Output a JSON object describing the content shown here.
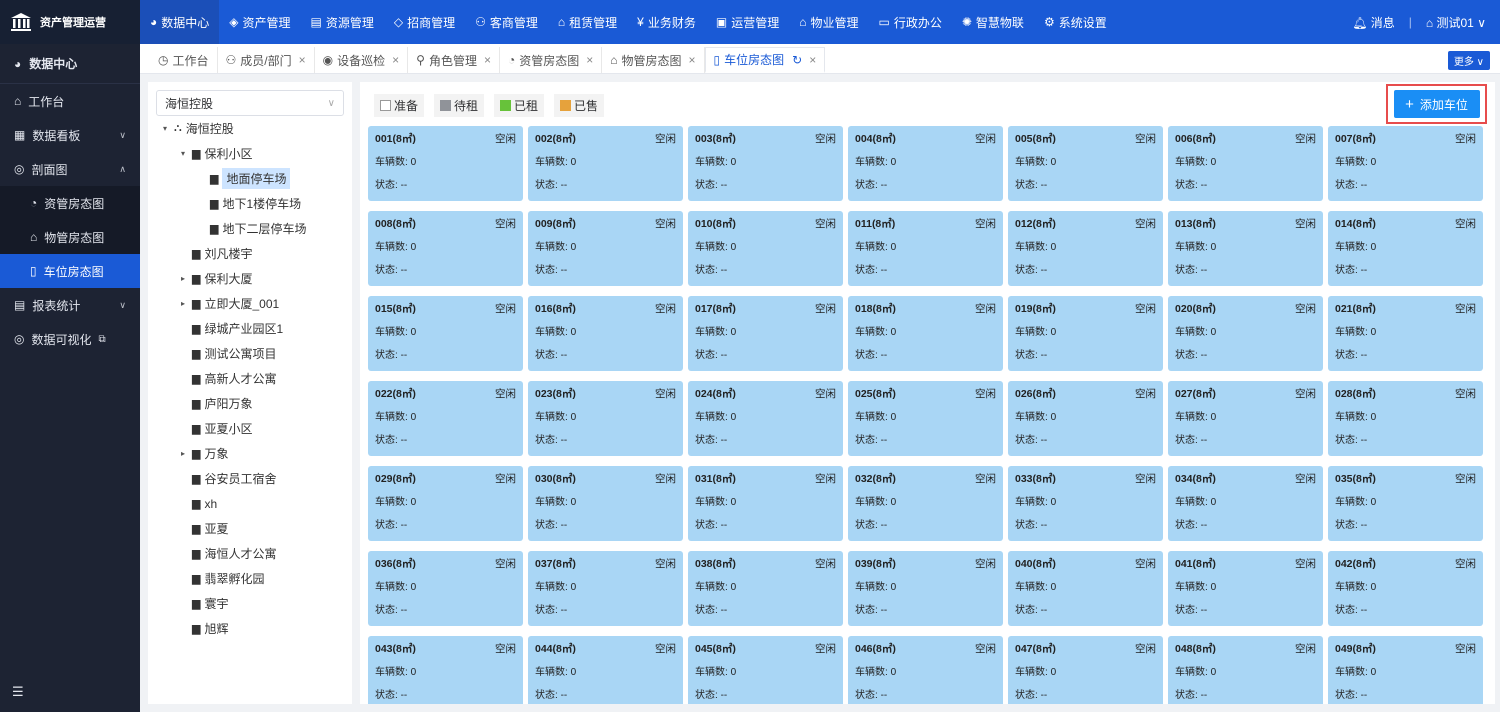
{
  "app": {
    "title": "资产管理运营"
  },
  "topnav": [
    {
      "label": "数据中心",
      "icon": "pie-icon",
      "active": true
    },
    {
      "label": "资产管理",
      "icon": "cube-icon"
    },
    {
      "label": "资源管理",
      "icon": "building-icon"
    },
    {
      "label": "招商管理",
      "icon": "tag-icon"
    },
    {
      "label": "客商管理",
      "icon": "users-icon"
    },
    {
      "label": "租赁管理",
      "icon": "house-icon"
    },
    {
      "label": "业务财务",
      "icon": "yen-icon"
    },
    {
      "label": "运营管理",
      "icon": "image-icon"
    },
    {
      "label": "物业管理",
      "icon": "home-icon"
    },
    {
      "label": "行政办公",
      "icon": "monitor-icon"
    },
    {
      "label": "智慧物联",
      "icon": "iot-icon"
    },
    {
      "label": "系统设置",
      "icon": "gear-icon"
    }
  ],
  "top_right": {
    "message": "消息",
    "user": "测试01"
  },
  "sidebar": {
    "header": "数据中心",
    "items": [
      {
        "label": "工作台"
      },
      {
        "label": "数据看板",
        "caret": "∨"
      },
      {
        "label": "剖面图",
        "caret": "∧"
      }
    ],
    "sub": [
      {
        "label": "资管房态图"
      },
      {
        "label": "物管房态图"
      },
      {
        "label": "车位房态图",
        "active": true
      }
    ],
    "items2": [
      {
        "label": "报表统计",
        "caret": "∨"
      },
      {
        "label": "数据可视化"
      }
    ]
  },
  "tabs": [
    {
      "label": "工作台",
      "close": false
    },
    {
      "label": "成员/部门",
      "close": true
    },
    {
      "label": "设备巡检",
      "close": true
    },
    {
      "label": "角色管理",
      "close": true
    },
    {
      "label": "资管房态图",
      "close": true
    },
    {
      "label": "物管房态图",
      "close": true
    },
    {
      "label": "车位房态图",
      "close": true,
      "active": true
    }
  ],
  "more_label": "更多",
  "tree": {
    "select_value": "海恒控股",
    "nodes": [
      {
        "label": "海恒控股",
        "level": 0,
        "arrow": "▾",
        "icon": "org"
      },
      {
        "label": "保利小区",
        "level": 1,
        "arrow": "▾",
        "icon": "bld"
      },
      {
        "label": "地面停车场",
        "level": 2,
        "arrow": "",
        "icon": "bld",
        "selected": true
      },
      {
        "label": "地下1楼停车场",
        "level": 2,
        "arrow": "",
        "icon": "bld"
      },
      {
        "label": "地下二层停车场",
        "level": 2,
        "arrow": "",
        "icon": "bld"
      },
      {
        "label": "刘凡楼宇",
        "level": 1,
        "arrow": "",
        "icon": "bld"
      },
      {
        "label": "保利大厦",
        "level": 1,
        "arrow": "▸",
        "icon": "bld"
      },
      {
        "label": "立即大厦_001",
        "level": 1,
        "arrow": "▸",
        "icon": "bld"
      },
      {
        "label": "绿城产业园区1",
        "level": 1,
        "arrow": "",
        "icon": "bld"
      },
      {
        "label": "测试公寓项目",
        "level": 1,
        "arrow": "",
        "icon": "bld"
      },
      {
        "label": "高新人才公寓",
        "level": 1,
        "arrow": "",
        "icon": "bld"
      },
      {
        "label": "庐阳万象",
        "level": 1,
        "arrow": "",
        "icon": "bld"
      },
      {
        "label": "亚夏小区",
        "level": 1,
        "arrow": "",
        "icon": "bld"
      },
      {
        "label": "万象",
        "level": 1,
        "arrow": "▸",
        "icon": "bld"
      },
      {
        "label": "谷安员工宿舍",
        "level": 1,
        "arrow": "",
        "icon": "bld"
      },
      {
        "label": "xh",
        "level": 1,
        "arrow": "",
        "icon": "bld"
      },
      {
        "label": "亚夏",
        "level": 1,
        "arrow": "",
        "icon": "bld"
      },
      {
        "label": "海恒人才公寓",
        "level": 1,
        "arrow": "",
        "icon": "bld"
      },
      {
        "label": "翡翠孵化园",
        "level": 1,
        "arrow": "",
        "icon": "bld"
      },
      {
        "label": "寰宇",
        "level": 1,
        "arrow": "",
        "icon": "bld"
      },
      {
        "label": "旭辉",
        "level": 1,
        "arrow": "",
        "icon": "bld"
      }
    ]
  },
  "legend": [
    {
      "label": "准备",
      "color": "#ffffff"
    },
    {
      "label": "待租",
      "color": "#909399"
    },
    {
      "label": "已租",
      "color": "#67c23a"
    },
    {
      "label": "已售",
      "color": "#e6a23c"
    }
  ],
  "add_button": "添加车位",
  "card_labels": {
    "vehicles": "车辆数:",
    "status": "状态:"
  },
  "spaces": [
    {
      "name": "001(8㎡)",
      "state": "空闲",
      "vehicles": "0",
      "status": "--"
    },
    {
      "name": "002(8㎡)",
      "state": "空闲",
      "vehicles": "0",
      "status": "--"
    },
    {
      "name": "003(8㎡)",
      "state": "空闲",
      "vehicles": "0",
      "status": "--"
    },
    {
      "name": "004(8㎡)",
      "state": "空闲",
      "vehicles": "0",
      "status": "--"
    },
    {
      "name": "005(8㎡)",
      "state": "空闲",
      "vehicles": "0",
      "status": "--"
    },
    {
      "name": "006(8㎡)",
      "state": "空闲",
      "vehicles": "0",
      "status": "--"
    },
    {
      "name": "007(8㎡)",
      "state": "空闲",
      "vehicles": "0",
      "status": "--"
    },
    {
      "name": "008(8㎡)",
      "state": "空闲",
      "vehicles": "0",
      "status": "--"
    },
    {
      "name": "009(8㎡)",
      "state": "空闲",
      "vehicles": "0",
      "status": "--"
    },
    {
      "name": "010(8㎡)",
      "state": "空闲",
      "vehicles": "0",
      "status": "--"
    },
    {
      "name": "011(8㎡)",
      "state": "空闲",
      "vehicles": "0",
      "status": "--"
    },
    {
      "name": "012(8㎡)",
      "state": "空闲",
      "vehicles": "0",
      "status": "--"
    },
    {
      "name": "013(8㎡)",
      "state": "空闲",
      "vehicles": "0",
      "status": "--"
    },
    {
      "name": "014(8㎡)",
      "state": "空闲",
      "vehicles": "0",
      "status": "--"
    },
    {
      "name": "015(8㎡)",
      "state": "空闲",
      "vehicles": "0",
      "status": "--"
    },
    {
      "name": "016(8㎡)",
      "state": "空闲",
      "vehicles": "0",
      "status": "--"
    },
    {
      "name": "017(8㎡)",
      "state": "空闲",
      "vehicles": "0",
      "status": "--"
    },
    {
      "name": "018(8㎡)",
      "state": "空闲",
      "vehicles": "0",
      "status": "--"
    },
    {
      "name": "019(8㎡)",
      "state": "空闲",
      "vehicles": "0",
      "status": "--"
    },
    {
      "name": "020(8㎡)",
      "state": "空闲",
      "vehicles": "0",
      "status": "--"
    },
    {
      "name": "021(8㎡)",
      "state": "空闲",
      "vehicles": "0",
      "status": "--"
    },
    {
      "name": "022(8㎡)",
      "state": "空闲",
      "vehicles": "0",
      "status": "--"
    },
    {
      "name": "023(8㎡)",
      "state": "空闲",
      "vehicles": "0",
      "status": "--"
    },
    {
      "name": "024(8㎡)",
      "state": "空闲",
      "vehicles": "0",
      "status": "--"
    },
    {
      "name": "025(8㎡)",
      "state": "空闲",
      "vehicles": "0",
      "status": "--"
    },
    {
      "name": "026(8㎡)",
      "state": "空闲",
      "vehicles": "0",
      "status": "--"
    },
    {
      "name": "027(8㎡)",
      "state": "空闲",
      "vehicles": "0",
      "status": "--"
    },
    {
      "name": "028(8㎡)",
      "state": "空闲",
      "vehicles": "0",
      "status": "--"
    },
    {
      "name": "029(8㎡)",
      "state": "空闲",
      "vehicles": "0",
      "status": "--"
    },
    {
      "name": "030(8㎡)",
      "state": "空闲",
      "vehicles": "0",
      "status": "--"
    },
    {
      "name": "031(8㎡)",
      "state": "空闲",
      "vehicles": "0",
      "status": "--"
    },
    {
      "name": "032(8㎡)",
      "state": "空闲",
      "vehicles": "0",
      "status": "--"
    },
    {
      "name": "033(8㎡)",
      "state": "空闲",
      "vehicles": "0",
      "status": "--"
    },
    {
      "name": "034(8㎡)",
      "state": "空闲",
      "vehicles": "0",
      "status": "--"
    },
    {
      "name": "035(8㎡)",
      "state": "空闲",
      "vehicles": "0",
      "status": "--"
    },
    {
      "name": "036(8㎡)",
      "state": "空闲",
      "vehicles": "0",
      "status": "--"
    },
    {
      "name": "037(8㎡)",
      "state": "空闲",
      "vehicles": "0",
      "status": "--"
    },
    {
      "name": "038(8㎡)",
      "state": "空闲",
      "vehicles": "0",
      "status": "--"
    },
    {
      "name": "039(8㎡)",
      "state": "空闲",
      "vehicles": "0",
      "status": "--"
    },
    {
      "name": "040(8㎡)",
      "state": "空闲",
      "vehicles": "0",
      "status": "--"
    },
    {
      "name": "041(8㎡)",
      "state": "空闲",
      "vehicles": "0",
      "status": "--"
    },
    {
      "name": "042(8㎡)",
      "state": "空闲",
      "vehicles": "0",
      "status": "--"
    },
    {
      "name": "043(8㎡)",
      "state": "空闲",
      "vehicles": "0",
      "status": "--"
    },
    {
      "name": "044(8㎡)",
      "state": "空闲",
      "vehicles": "0",
      "status": "--"
    },
    {
      "name": "045(8㎡)",
      "state": "空闲",
      "vehicles": "0",
      "status": "--"
    },
    {
      "name": "046(8㎡)",
      "state": "空闲",
      "vehicles": "0",
      "status": "--"
    },
    {
      "name": "047(8㎡)",
      "state": "空闲",
      "vehicles": "0",
      "status": "--"
    },
    {
      "name": "048(8㎡)",
      "state": "空闲",
      "vehicles": "0",
      "status": "--"
    },
    {
      "name": "049(8㎡)",
      "state": "空闲",
      "vehicles": "0",
      "status": "--"
    }
  ]
}
